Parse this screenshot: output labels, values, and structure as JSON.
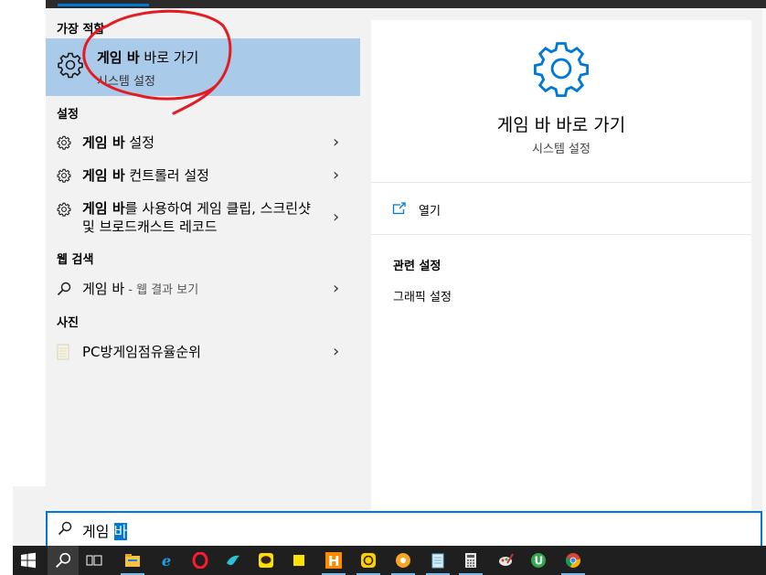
{
  "sections": {
    "best_match": "가장 적합",
    "settings": "설정",
    "web_search": "웹 검색",
    "photos": "사진"
  },
  "best_match": {
    "title_bold": "게임 바",
    "title_rest": " 바로 가기",
    "subtitle": "시스템 설정"
  },
  "settings_items": [
    {
      "bold": "게임 바",
      "rest": " 설정"
    },
    {
      "bold": "게임 바",
      "rest": " 컨트롤러 설정"
    },
    {
      "bold": "게임 바",
      "rest": "를 사용하여 게임 클립, 스크린샷 및 브로드캐스트 레코드"
    }
  ],
  "web_item": {
    "query": "게임 바",
    "suffix": " - 웹 결과 보기"
  },
  "photo_item": {
    "label": "PC방게임점유율순위"
  },
  "detail": {
    "title": "게임 바 바로 가기",
    "subtitle": "시스템 설정",
    "open_label": "열기",
    "related_header": "관련 설정",
    "related_items": [
      "그래픽 설정"
    ]
  },
  "search": {
    "typed": "게임 ",
    "selected": "바"
  },
  "colors": {
    "accent": "#0078d7",
    "highlight": "#a9cbe9",
    "annotation": "#e31b23",
    "taskbar": "#1f1f1f"
  },
  "taskbar": {
    "icons": [
      "windows-start-icon",
      "search-icon",
      "task-view-icon",
      "file-explorer-icon",
      "internet-explorer-icon",
      "opera-icon",
      "bird-app-icon",
      "kakaotalk-icon",
      "sticky-note-icon",
      "hangul-word-icon",
      "kakaotalk-alt-icon",
      "chrome-orange-icon",
      "notepad-icon",
      "calculator-icon",
      "paint-icon",
      "utorrent-icon",
      "chrome-icon"
    ]
  }
}
